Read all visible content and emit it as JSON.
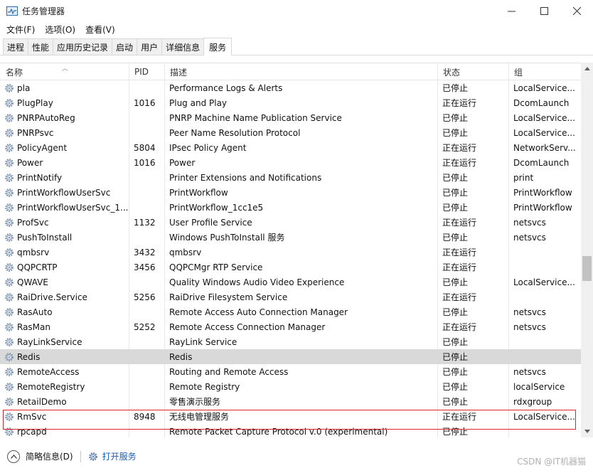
{
  "window": {
    "title": "任务管理器",
    "minimize": "—",
    "maximize": "☐",
    "close": "✕"
  },
  "menu": [
    "文件(F)",
    "选项(O)",
    "查看(V)"
  ],
  "tabs": [
    {
      "label": "进程",
      "active": false
    },
    {
      "label": "性能",
      "active": false
    },
    {
      "label": "应用历史记录",
      "active": false
    },
    {
      "label": "启动",
      "active": false
    },
    {
      "label": "用户",
      "active": false
    },
    {
      "label": "详细信息",
      "active": false
    },
    {
      "label": "服务",
      "active": true
    }
  ],
  "columns": {
    "name": "名称",
    "pid": "PID",
    "desc": "描述",
    "status": "状态",
    "group": "组"
  },
  "rows": [
    {
      "name": "pla",
      "pid": "",
      "desc": "Performance Logs & Alerts",
      "status": "已停止",
      "group": "LocalService..."
    },
    {
      "name": "PlugPlay",
      "pid": "1016",
      "desc": "Plug and Play",
      "status": "正在运行",
      "group": "DcomLaunch"
    },
    {
      "name": "PNRPAutoReg",
      "pid": "",
      "desc": "PNRP Machine Name Publication Service",
      "status": "已停止",
      "group": "LocalService..."
    },
    {
      "name": "PNRPsvc",
      "pid": "",
      "desc": "Peer Name Resolution Protocol",
      "status": "已停止",
      "group": "LocalService..."
    },
    {
      "name": "PolicyAgent",
      "pid": "5804",
      "desc": "IPsec Policy Agent",
      "status": "正在运行",
      "group": "NetworkServ..."
    },
    {
      "name": "Power",
      "pid": "1016",
      "desc": "Power",
      "status": "正在运行",
      "group": "DcomLaunch"
    },
    {
      "name": "PrintNotify",
      "pid": "",
      "desc": "Printer Extensions and Notifications",
      "status": "已停止",
      "group": "print"
    },
    {
      "name": "PrintWorkflowUserSvc",
      "pid": "",
      "desc": "PrintWorkflow",
      "status": "已停止",
      "group": "PrintWorkflow"
    },
    {
      "name": "PrintWorkflowUserSvc_1...",
      "pid": "",
      "desc": "PrintWorkflow_1cc1e5",
      "status": "已停止",
      "group": "PrintWorkflow"
    },
    {
      "name": "ProfSvc",
      "pid": "1132",
      "desc": "User Profile Service",
      "status": "正在运行",
      "group": "netsvcs"
    },
    {
      "name": "PushToInstall",
      "pid": "",
      "desc": "Windows PushToInstall 服务",
      "status": "已停止",
      "group": "netsvcs"
    },
    {
      "name": "qmbsrv",
      "pid": "3432",
      "desc": "qmbsrv",
      "status": "正在运行",
      "group": ""
    },
    {
      "name": "QQPCRTP",
      "pid": "3456",
      "desc": "QQPCMgr RTP Service",
      "status": "正在运行",
      "group": ""
    },
    {
      "name": "QWAVE",
      "pid": "",
      "desc": "Quality Windows Audio Video Experience",
      "status": "已停止",
      "group": "LocalService..."
    },
    {
      "name": "RaiDrive.Service",
      "pid": "5256",
      "desc": "RaiDrive Filesystem Service",
      "status": "正在运行",
      "group": ""
    },
    {
      "name": "RasAuto",
      "pid": "",
      "desc": "Remote Access Auto Connection Manager",
      "status": "已停止",
      "group": "netsvcs"
    },
    {
      "name": "RasMan",
      "pid": "5252",
      "desc": "Remote Access Connection Manager",
      "status": "正在运行",
      "group": "netsvcs"
    },
    {
      "name": "RayLinkService",
      "pid": "",
      "desc": "RayLink Service",
      "status": "已停止",
      "group": ""
    },
    {
      "name": "Redis",
      "pid": "",
      "desc": "Redis",
      "status": "已停止",
      "group": "",
      "selected": true
    },
    {
      "name": "RemoteAccess",
      "pid": "",
      "desc": "Routing and Remote Access",
      "status": "已停止",
      "group": "netsvcs"
    },
    {
      "name": "RemoteRegistry",
      "pid": "",
      "desc": "Remote Registry",
      "status": "已停止",
      "group": "localService"
    },
    {
      "name": "RetailDemo",
      "pid": "",
      "desc": "零售演示服务",
      "status": "已停止",
      "group": "rdxgroup"
    },
    {
      "name": "RmSvc",
      "pid": "8948",
      "desc": "无线电管理服务",
      "status": "正在运行",
      "group": "LocalService..."
    },
    {
      "name": "rpcapd",
      "pid": "",
      "desc": "Remote Packet Capture Protocol v.0 (experimental)",
      "status": "已停止",
      "group": ""
    }
  ],
  "footer": {
    "brief": "简略信息(D)",
    "open_services": "打开服务",
    "watermark": "CSDN @IT机器猫"
  },
  "colors": {
    "selected_row": "#d9d9d9",
    "highlight_box": "#e0242a",
    "link": "#1a5fb4"
  },
  "icons": {
    "service": "gear-icon",
    "collapse": "chevron-up-circle-icon"
  }
}
